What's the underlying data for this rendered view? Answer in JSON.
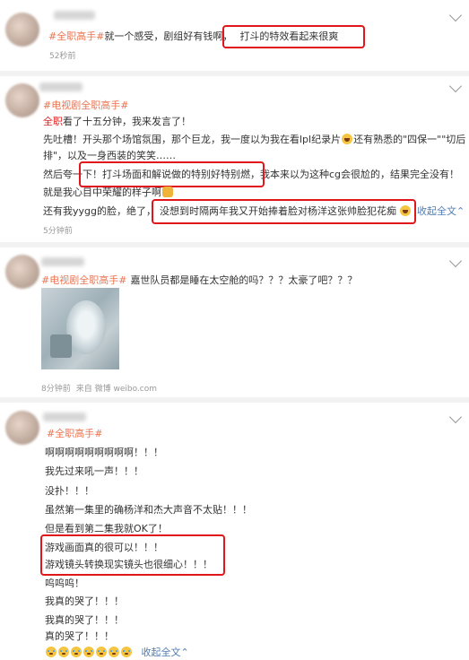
{
  "post1": {
    "tag": "#全职高手#",
    "text": "就一个感受，剧组好有钱啊，",
    "highlight": "打斗的特效看起来很爽",
    "time": "52秒前"
  },
  "post2": {
    "tag": "#电视剧全职高手#",
    "lines": [
      {
        "pre_red": "全职",
        "text": "看了十五分钟，我来发言了！"
      },
      {
        "text": "先吐槽！开头那个场馆氛围，那个巨龙，我一度以为我在看lpl纪录片",
        "after": "还有熟悉的\"四保一\"\"切后"
      },
      {
        "text": "排\"，以及一身西装的笑笑……"
      },
      {
        "pre": "然后夸一下！",
        "boxed": "打斗场面和解说做的特别好特别燃，",
        "post": "我本来以为这种cg会很尬的，结果完全没有！"
      },
      {
        "text": "就是我心目中荣耀的样子啊"
      },
      {
        "pre": "还有我yygg的脸，绝了，",
        "boxed": "没想到时隔两年我又开始捧着脸对杨洋这张帅脸犯花痴",
        "collapse": "收起全文"
      }
    ],
    "time": "5分钟前"
  },
  "post3": {
    "tag": "#电视剧全职高手#",
    "text": "嘉世队员都是睡在太空舱的吗？？？太豪了吧？？？",
    "time": "8分钟前",
    "source": "来自 微博 weibo.com"
  },
  "post4": {
    "tag": "#全职高手#",
    "lines": [
      "啊啊啊啊啊啊啊啊啊！！！",
      "我先过来吼一声！！！",
      "没扑！！！",
      "虽然第一集里的确杨洋和杰大声音不太贴！！！",
      "但是看到第二集我就OK了！",
      "游戏画面真的很可以！！！",
      "游戏镜头转换现实镜头也很细心！！！",
      "呜呜呜！",
      "我真的哭了！！！",
      "我真的哭了！！！",
      "真的哭了！！！"
    ],
    "collapse": "收起全文"
  },
  "colors": {
    "tag": "#eb7350",
    "highlight_box": "#e0161a",
    "link": "#507daf"
  }
}
